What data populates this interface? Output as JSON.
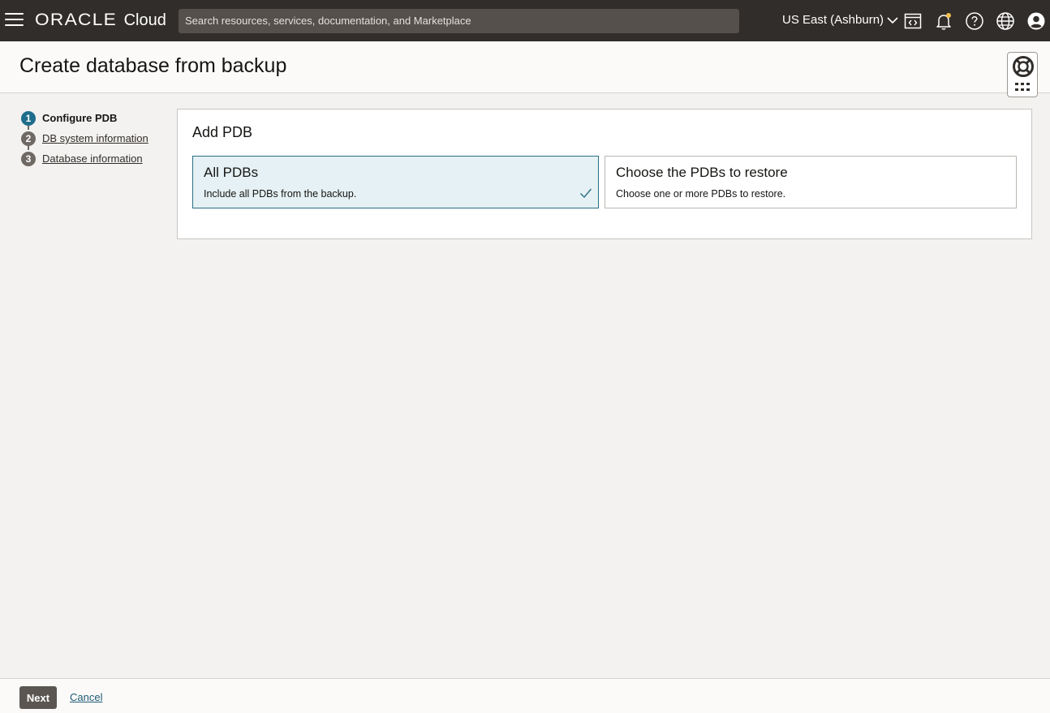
{
  "topbar": {
    "brand_oracle": "ORACLE",
    "brand_cloud": "Cloud",
    "search_placeholder": "Search resources, services, documentation, and Marketplace",
    "region": "US East (Ashburn)",
    "icons": [
      "menu-icon",
      "chevron-down-icon",
      "code-editor-icon",
      "bell-icon",
      "help-icon",
      "globe-icon",
      "user-avatar-icon"
    ]
  },
  "header": {
    "title": "Create database from backup",
    "help_widget_icons": [
      "lifebuoy-icon",
      "apps-grid-icon"
    ]
  },
  "steps": [
    {
      "number": "1",
      "label": "Configure PDB",
      "state": "current"
    },
    {
      "number": "2",
      "label": "DB system information",
      "state": "link"
    },
    {
      "number": "3",
      "label": "Database information",
      "state": "link"
    }
  ],
  "main": {
    "section_title": "Add PDB",
    "options": [
      {
        "title": "All PDBs",
        "description": "Include all PDBs from the backup.",
        "selected": true
      },
      {
        "title": "Choose the PDBs to restore",
        "description": "Choose one or more PDBs to restore.",
        "selected": false
      }
    ]
  },
  "footer": {
    "next_label": "Next",
    "cancel_label": "Cancel"
  },
  "colors": {
    "topbar_bg": "#312d2a",
    "page_bg": "#f3f2f0",
    "step_active": "#1f6d8c",
    "step_inactive": "#6f6964",
    "selected_tile_bg": "#e5f1f4",
    "selected_tile_border": "#2a6e85",
    "next_button_bg": "#5b5652"
  }
}
